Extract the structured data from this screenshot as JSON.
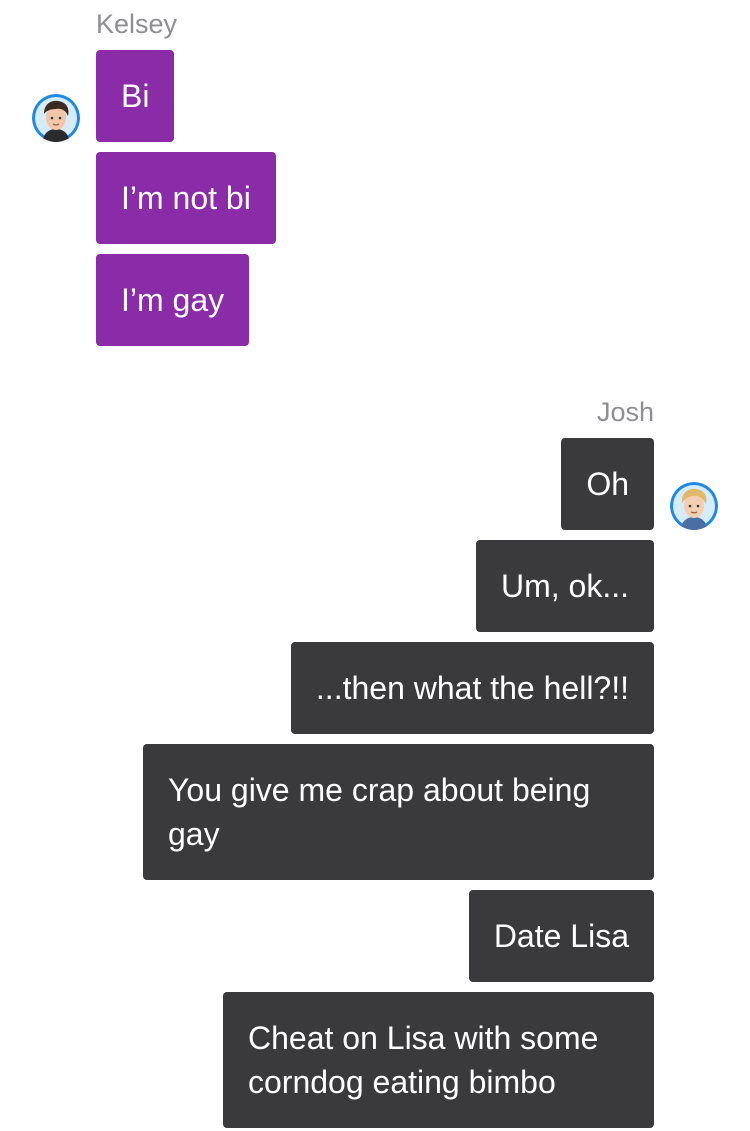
{
  "conversation": {
    "kelsey": {
      "name": "Kelsey",
      "messages": [
        "Bi",
        "I’m not bi",
        "I’m gay"
      ]
    },
    "josh": {
      "name": "Josh",
      "messages": [
        "Oh",
        "Um, ok...",
        "...then what the hell?!!",
        "You give me crap about being gay",
        "Date Lisa",
        "Cheat on Lisa with some corndog eating bimbo"
      ]
    }
  },
  "colors": {
    "incoming_bubble": "#8a2ba8",
    "outgoing_bubble": "#3a3a3c",
    "sender_name": "#8e8e93",
    "avatar_ring": "#1e88e5"
  },
  "icons": {
    "kelsey_avatar": "dark-haired-boy-avatar",
    "josh_avatar": "blond-boy-avatar"
  }
}
